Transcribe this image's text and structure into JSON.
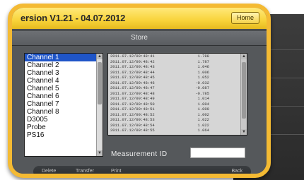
{
  "title_bar": {
    "version": "ersion V1.21 - 04.07.2012",
    "home_label": "Home"
  },
  "store_bar": {
    "title": "Store"
  },
  "channel_list": {
    "items": [
      "Channel 1",
      "Channel 2",
      "Channel 3",
      "Channel 4",
      "Channel 5",
      "Channel 6",
      "Channel 7",
      "Channel 8",
      "D3005",
      "Probe",
      "PS16"
    ],
    "selected": "Channel 1"
  },
  "data_list": {
    "rows": [
      {
        "ts": "2011.07.12/09:48:41",
        "value": "1.788"
      },
      {
        "ts": "2011.07.12/09:48:42",
        "value": "1.787"
      },
      {
        "ts": "2011.07.12/09:48:43",
        "value": "1.046"
      },
      {
        "ts": "2011.07.12/09:48:44",
        "value": "1.006"
      },
      {
        "ts": "2011.07.12/09:48:45",
        "value": "1.052"
      },
      {
        "ts": "2011.07.12/09:48:46",
        "value": "-0.032"
      },
      {
        "ts": "2011.07.12/09:48:47",
        "value": "-0.087"
      },
      {
        "ts": "2011.07.12/09:48:48",
        "value": "-0.785"
      },
      {
        "ts": "2011.07.12/09:48:49",
        "value": "1.014"
      },
      {
        "ts": "2011.07.12/09:48:50",
        "value": "1.004"
      },
      {
        "ts": "2011.07.12/09:48:51",
        "value": "1.000"
      },
      {
        "ts": "2011.07.12/09:48:52",
        "value": "1.002"
      },
      {
        "ts": "2011.07.12/09:48:53",
        "value": "1.022"
      },
      {
        "ts": "2011.07.12/09:48:54",
        "value": "1.022"
      },
      {
        "ts": "2011.07.12/09:48:55",
        "value": "1.064"
      }
    ]
  },
  "measurement": {
    "label": "Measurement ID",
    "value": ""
  },
  "toolbar": {
    "delete": "Delete",
    "transfer": "Transfer",
    "print": "Print",
    "back": "Back"
  },
  "colors": {
    "frame": "#f4ba33",
    "selection": "#1f55c8",
    "titlebar": "#f8d33a"
  }
}
